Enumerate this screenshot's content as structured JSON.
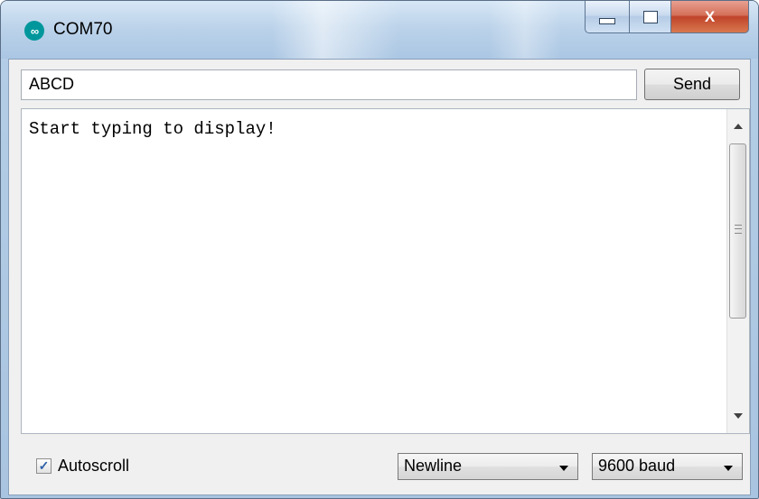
{
  "window": {
    "title": "COM70",
    "icon": "arduino-icon",
    "icon_glyph": "∞",
    "controls": {
      "close_glyph": "X"
    }
  },
  "send": {
    "input_value": "ABCD",
    "button_label": "Send"
  },
  "output": {
    "text": "Start typing to display!"
  },
  "footer": {
    "autoscroll_label": "Autoscroll",
    "autoscroll_checked": true,
    "check_glyph": "✓",
    "line_ending": "Newline",
    "baud_rate": "9600 baud"
  },
  "colors": {
    "arduino_teal": "#00979c",
    "close_red": "#c0432a"
  }
}
